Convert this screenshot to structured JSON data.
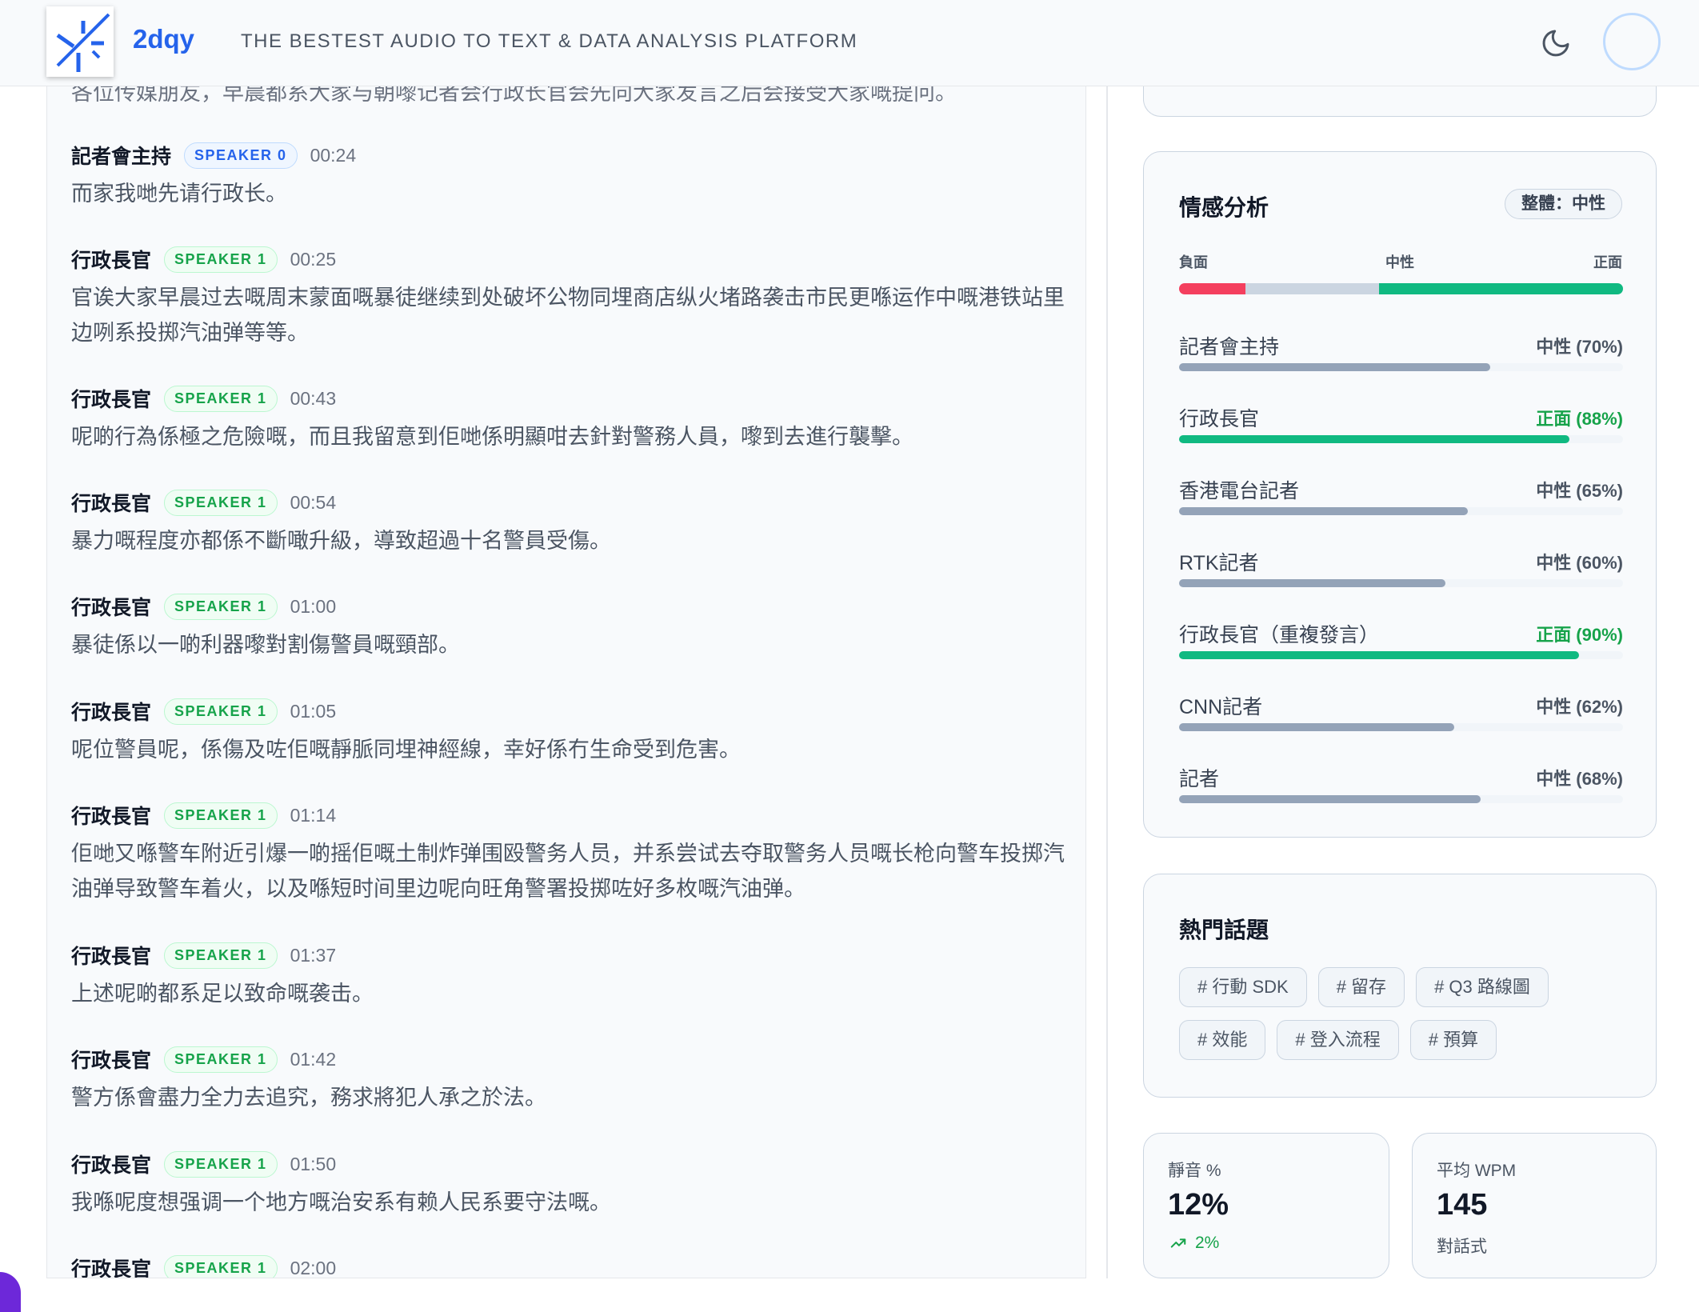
{
  "header": {
    "brand": "2dqy",
    "tagline": "THE BESTEST AUDIO TO TEXT & DATA ANALYSIS PLATFORM",
    "logo_icon": "sparkle-logo-icon",
    "theme_icon": "moon-icon",
    "accent_color": "#2563eb"
  },
  "transcript": {
    "partial_line": "各位传媒朋友，早晨都系大家与朝嚟记者会行政长官会先向大家发言之后会接受大家嘅提问。",
    "entries": [
      {
        "speaker": "記者會主持",
        "badge": "SPEAKER 0",
        "time": "00:24",
        "text": "而家我哋先请行政长。"
      },
      {
        "speaker": "行政長官",
        "badge": "SPEAKER 1",
        "time": "00:25",
        "text": "官诶大家早晨过去嘅周末蒙面嘅暴徒继续到处破坏公物同埋商店纵火堵路袭击市民更喺运作中嘅港铁站里边咧系投掷汽油弹等等。"
      },
      {
        "speaker": "行政長官",
        "badge": "SPEAKER 1",
        "time": "00:43",
        "text": "呢啲行為係極之危險嘅，而且我留意到佢哋係明顯咁去針對警務人員，嚟到去進行襲擊。"
      },
      {
        "speaker": "行政長官",
        "badge": "SPEAKER 1",
        "time": "00:54",
        "text": "暴力嘅程度亦都係不斷噉升級，導致超過十名警員受傷。"
      },
      {
        "speaker": "行政長官",
        "badge": "SPEAKER 1",
        "time": "01:00",
        "text": "暴徒係以一啲利器嚟對割傷警員嘅頸部。"
      },
      {
        "speaker": "行政長官",
        "badge": "SPEAKER 1",
        "time": "01:05",
        "text": "呢位警員呢，係傷及咗佢嘅靜脈同埋神經線，幸好係冇生命受到危害。"
      },
      {
        "speaker": "行政長官",
        "badge": "SPEAKER 1",
        "time": "01:14",
        "text": "佢哋又喺警车附近引爆一啲摇佢嘅土制炸弹围殴警务人员，并系尝试去夺取警务人员嘅长枪向警车投掷汽油弹导致警车着火，以及喺短时间里边呢向旺角警署投掷咗好多枚嘅汽油弹。"
      },
      {
        "speaker": "行政長官",
        "badge": "SPEAKER 1",
        "time": "01:37",
        "text": "上述呢啲都系足以致命嘅袭击。"
      },
      {
        "speaker": "行政長官",
        "badge": "SPEAKER 1",
        "time": "01:42",
        "text": "警方係會盡力全力去追究，務求將犯人承之於法。"
      },
      {
        "speaker": "行政長官",
        "badge": "SPEAKER 1",
        "time": "01:50",
        "text": "我喺呢度想强调一个地方嘅治安系有赖人民系要守法嘅。"
      },
      {
        "speaker": "行政長官",
        "badge": "SPEAKER 1",
        "time": "02:00",
        "text": ""
      }
    ]
  },
  "sentiment": {
    "title": "情感分析",
    "overall": "整體：中性",
    "scale": {
      "negative": "負面",
      "neutral": "中性",
      "positive": "正面"
    },
    "distribution": {
      "negative": 0.15,
      "neutral": 0.3,
      "positive": 0.55
    },
    "rows": [
      {
        "name": "記者會主持",
        "label": "中性 (70%)",
        "value": 0.7,
        "tone": "neutral"
      },
      {
        "name": "行政長官",
        "label": "正面 (88%)",
        "value": 0.88,
        "tone": "positive"
      },
      {
        "name": "香港電台記者",
        "label": "中性 (65%)",
        "value": 0.65,
        "tone": "neutral"
      },
      {
        "name": "RTK記者",
        "label": "中性 (60%)",
        "value": 0.6,
        "tone": "neutral"
      },
      {
        "name": "行政長官（重複發言）",
        "label": "正面 (90%)",
        "value": 0.9,
        "tone": "positive"
      },
      {
        "name": "CNN記者",
        "label": "中性 (62%)",
        "value": 0.62,
        "tone": "neutral"
      },
      {
        "name": "記者",
        "label": "中性 (68%)",
        "value": 0.68,
        "tone": "neutral"
      }
    ],
    "colors": {
      "negative": "#f43f5e",
      "neutral": "#cbd5e1",
      "positive": "#10b981",
      "neutral_fill": "#94a3b8"
    }
  },
  "topics": {
    "title": "熱門話題",
    "tags": [
      "# 行動 SDK",
      "# 留存",
      "# Q3 路線圖",
      "# 效能",
      "# 登入流程",
      "# 預算"
    ]
  },
  "metrics": [
    {
      "label": "靜音 %",
      "value": "12%",
      "sub": "2%",
      "sub_icon": "trend-up-icon"
    },
    {
      "label": "平均 WPM",
      "value": "145",
      "sub": "對話式"
    }
  ]
}
